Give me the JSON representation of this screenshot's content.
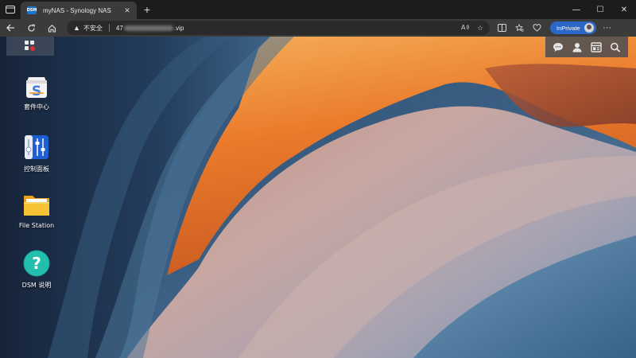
{
  "browser": {
    "tab": {
      "favicon_text": "DSM",
      "title": "myNAS - Synology NAS"
    },
    "address": {
      "security_label": "不安全",
      "url_prefix": "47",
      "url_suffix": ".vip"
    },
    "profile_label": "InPrivate"
  },
  "dsm": {
    "desktop_icons": [
      {
        "label": "套件中心",
        "icon": "package-center-icon"
      },
      {
        "label": "控制面板",
        "icon": "control-panel-icon"
      },
      {
        "label": "File Station",
        "icon": "file-station-icon"
      },
      {
        "label": "DSM 说明",
        "icon": "dsm-help-icon"
      }
    ],
    "top_right_icons": [
      "chat-icon",
      "user-icon",
      "widgets-icon",
      "search-icon"
    ]
  },
  "colors": {
    "accent_inprivate": "#2b67c7",
    "chrome_dark": "#1c1c1c",
    "chrome_mid": "#3b3b3b"
  }
}
